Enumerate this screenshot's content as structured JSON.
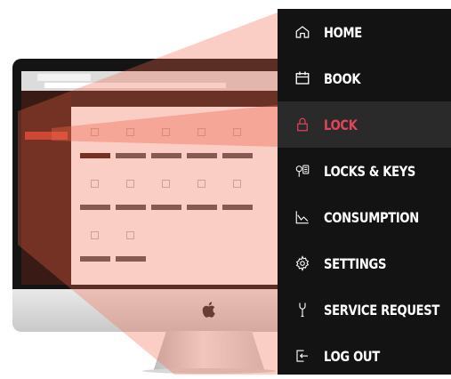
{
  "colors": {
    "menu_background": "#131313",
    "active_background": "#2a2a2a",
    "active_accent": "#e0455a",
    "menu_text": "#ffffff",
    "highlight_overlay": "#ee664a"
  },
  "menu": {
    "items": [
      {
        "label": "HOME",
        "icon": "home-icon"
      },
      {
        "label": "BOOK",
        "icon": "calendar-icon"
      },
      {
        "label": "LOCK",
        "icon": "lock-icon",
        "active": true
      },
      {
        "label": "LOCKS & KEYS",
        "icon": "keys-icon"
      },
      {
        "label": "CONSUMPTION",
        "icon": "chart-icon"
      },
      {
        "label": "SETTINGS",
        "icon": "gear-icon"
      },
      {
        "label": "SERVICE REQUEST",
        "icon": "wrench-icon"
      },
      {
        "label": "LOG OUT",
        "icon": "logout-icon"
      }
    ]
  }
}
